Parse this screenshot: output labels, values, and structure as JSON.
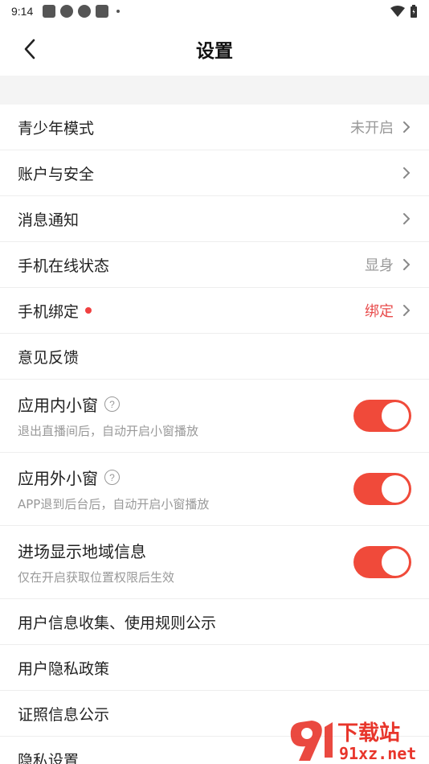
{
  "status_bar": {
    "time": "9:14"
  },
  "header": {
    "title": "设置"
  },
  "settings": [
    {
      "label": "青少年模式",
      "value": "未开启",
      "value_style": "grey",
      "has_arrow": true
    },
    {
      "label": "账户与安全",
      "value": "",
      "has_arrow": true
    },
    {
      "label": "消息通知",
      "value": "",
      "has_arrow": true
    },
    {
      "label": "手机在线状态",
      "value": "显身",
      "value_style": "grey",
      "has_arrow": true
    },
    {
      "label": "手机绑定",
      "value": "绑定",
      "value_style": "red",
      "has_arrow": true,
      "red_dot": true
    },
    {
      "label": "意见反馈",
      "value": "",
      "has_arrow": false
    }
  ],
  "toggles": [
    {
      "title": "应用内小窗",
      "desc": "退出直播间后，自动开启小窗播放",
      "on": true,
      "help": true
    },
    {
      "title": "应用外小窗",
      "desc": "APP退到后台后，自动开启小窗播放",
      "on": true,
      "help": true
    },
    {
      "title": "进场显示地域信息",
      "desc": "仅在开启获取位置权限后生效",
      "on": true,
      "help": false
    }
  ],
  "links": [
    {
      "label": "用户信息收集、使用规则公示"
    },
    {
      "label": "用户隐私政策"
    },
    {
      "label": "证照信息公示"
    },
    {
      "label": "隐私设置"
    }
  ],
  "watermark": {
    "line1": "下载站",
    "line2": "91xz.net"
  },
  "colors": {
    "accent": "#f04a3a",
    "red_text": "#e84b4b",
    "divider": "#eeeeee",
    "gap_bg": "#f4f4f4"
  }
}
